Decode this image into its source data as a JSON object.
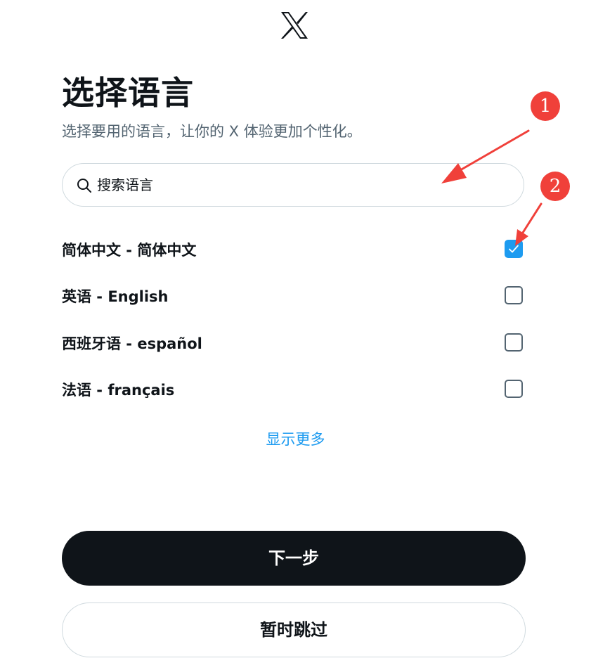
{
  "header": {
    "logo_icon": "x-logo-icon"
  },
  "page": {
    "title": "选择语言",
    "subtitle": "选择要用的语言，让你的 X 体验更加个性化。"
  },
  "search": {
    "placeholder": "搜索语言",
    "value": "",
    "icon": "search-icon"
  },
  "languages": [
    {
      "label": "简体中文 - 简体中文",
      "checked": true
    },
    {
      "label": "英语 - English",
      "checked": false
    },
    {
      "label": "西班牙语 - español",
      "checked": false
    },
    {
      "label": "法语 - français",
      "checked": false
    }
  ],
  "show_more": "显示更多",
  "buttons": {
    "next": "下一步",
    "skip": "暂时跳过"
  },
  "annotations": {
    "badge_1": "1",
    "badge_2": "2",
    "color": "#f0403a"
  },
  "colors": {
    "accent": "#1d9bf0",
    "primary_button": "#0f1419",
    "muted_text": "#536471",
    "border": "#cfd9de"
  }
}
